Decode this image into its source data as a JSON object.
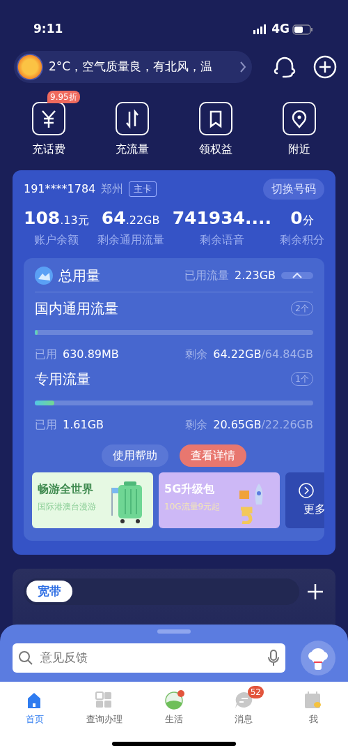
{
  "status_bar": {
    "time": "9:11",
    "network": "4G"
  },
  "weather": {
    "text": "2°C，空气质量良，有北风，温"
  },
  "quick_actions": [
    {
      "label": "充话费",
      "badge": "9.95折",
      "kind": "yuan"
    },
    {
      "label": "充流量",
      "kind": "arrows"
    },
    {
      "label": "领权益",
      "kind": "bookmark"
    },
    {
      "label": "附近",
      "kind": "pin"
    }
  ],
  "account": {
    "number": "191****1784",
    "city": "郑州",
    "tag": "主卡",
    "switch_button": "切换号码",
    "stats": [
      {
        "main": "108",
        "unit": ".13元",
        "label": "账户余额"
      },
      {
        "main": "64",
        "unit": ".22GB",
        "label": "剩余通用流量"
      },
      {
        "main": "741934....",
        "label": "剩余语音"
      },
      {
        "main": "0",
        "unit": "分",
        "label": "剩余积分"
      }
    ]
  },
  "usage": {
    "title": "总用量",
    "used_label": "已用流量",
    "used_value": "2.23GB",
    "expanded": true,
    "sections": [
      {
        "name": "国内通用流量",
        "count": "2个",
        "level": 0.01,
        "used_label": "已用",
        "used": "630.89MB",
        "remain_label": "剩余",
        "remain": "64.22GB",
        "total": "/64.84GB"
      },
      {
        "name": "专用流量",
        "count": "1个",
        "level": 0.07,
        "used_label": "已用",
        "used": "1.61GB",
        "remain_label": "剩余",
        "remain": "20.65GB",
        "total": "/22.26GB"
      }
    ],
    "buttons": [
      {
        "label": "使用帮助",
        "kind": "secondary"
      },
      {
        "label": "查看详情",
        "kind": "primary"
      }
    ],
    "promos": [
      {
        "title": "畅游全世界",
        "subtitle": "国际港澳台漫游",
        "kind": "travel"
      },
      {
        "title": "5G升级包",
        "subtitle": "10G流量9元起",
        "kind": "fiveg"
      },
      {
        "title": "更多",
        "kind": "more"
      }
    ]
  },
  "broadband": {
    "tab": "宽带"
  },
  "search": {
    "placeholder": "意见反馈"
  },
  "tab_bar": [
    {
      "label": "首页",
      "selected": true,
      "kind": "home"
    },
    {
      "label": "查询办理",
      "selected": false,
      "kind": "grid"
    },
    {
      "label": "生活",
      "selected": false,
      "kind": "life",
      "dot": true
    },
    {
      "label": "消息",
      "selected": false,
      "kind": "message",
      "badge": "52"
    },
    {
      "label": "我",
      "selected": false,
      "kind": "me"
    }
  ]
}
